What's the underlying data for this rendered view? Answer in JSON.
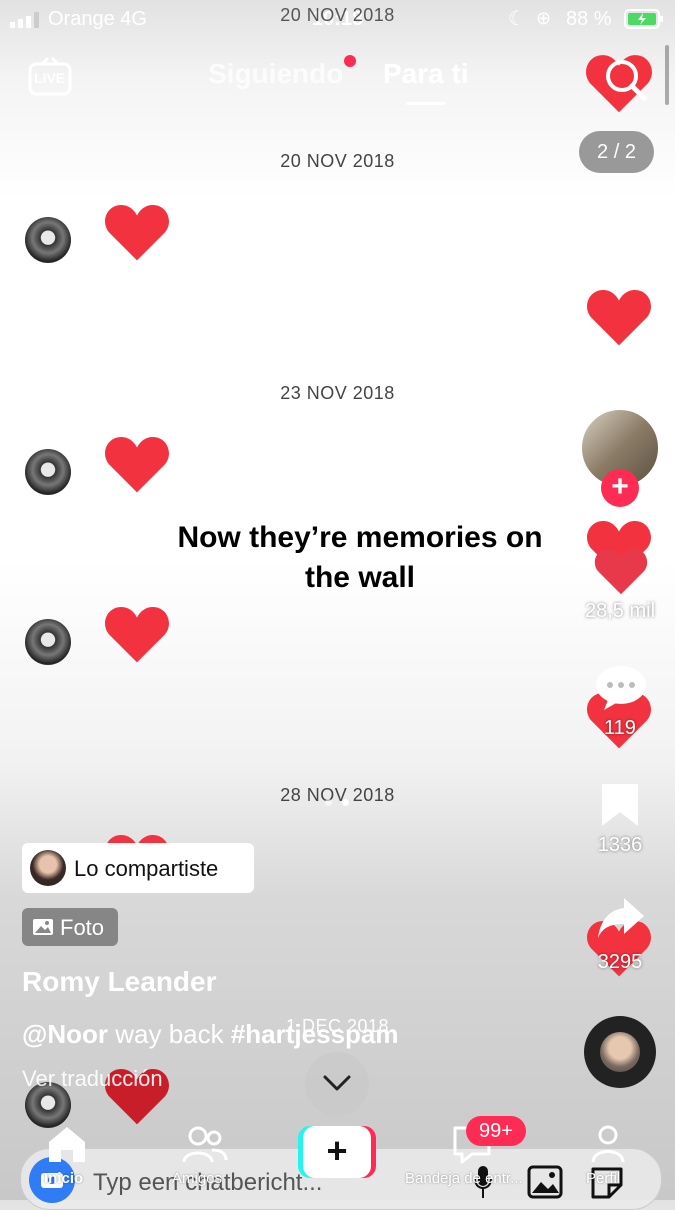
{
  "status": {
    "carrier": "Orange  4G",
    "time": "10:18",
    "battery": "88 %"
  },
  "header": {
    "live_label": "LIVE",
    "tab_following": "Siguiendo",
    "tab_foryou": "Para ti",
    "page_counter": "2 / 2"
  },
  "dates": [
    "20 NOV 2018",
    "20 NOV 2018",
    "23 NOV 2018",
    "28 NOV 2018",
    "1 DEC 2018"
  ],
  "overlay_text": {
    "line1": "Now they’re memories on",
    "line2": "the wall"
  },
  "actions": {
    "likes": "28,5 mil",
    "comments": "119",
    "saves": "1336",
    "shares": "3295"
  },
  "post": {
    "shared_badge": "Lo compartiste",
    "type_badge": "Foto",
    "author": "Romy Leander",
    "caption_mention": "@Noor",
    "caption_text": " way back ",
    "caption_hashtag": "#hartjesspam",
    "translate": "Ver traducción"
  },
  "chat": {
    "placeholder": "Typ een chatbericht..."
  },
  "nav": {
    "home": "Inicio",
    "friends": "Amigos",
    "inbox": "Bandeja de entr...",
    "inbox_badge": "99+",
    "profile": "Perfil"
  },
  "colors": {
    "heart": "#f2333f",
    "accent": "#fe2c55"
  }
}
